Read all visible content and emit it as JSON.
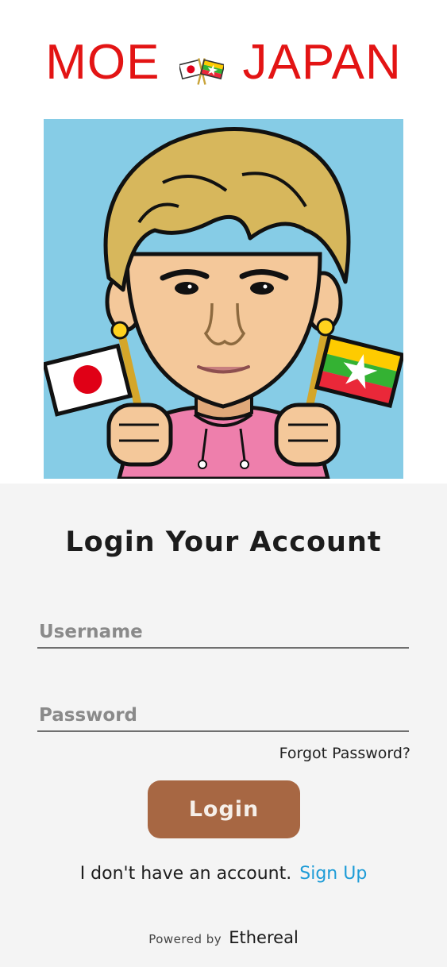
{
  "header": {
    "brand_left": "MOE",
    "brand_right": "JAPAN",
    "brand_color": "#e31414",
    "brand_icon": "japan-myanmar-flags-icon"
  },
  "avatar": {
    "icon": "cartoon-avatar-holding-flags",
    "background_color": "#86cce6"
  },
  "login": {
    "title": "Login Your Account",
    "username_placeholder": "Username",
    "password_placeholder": "Password",
    "forgot_label": "Forgot Password?",
    "login_label": "Login",
    "login_color": "#a76743",
    "no_account_text": "I don't have an account.",
    "signup_label": "Sign Up",
    "signup_color": "#1e9cd7"
  },
  "footer": {
    "powered_by": "Powered by",
    "maker": "Ethereal"
  }
}
